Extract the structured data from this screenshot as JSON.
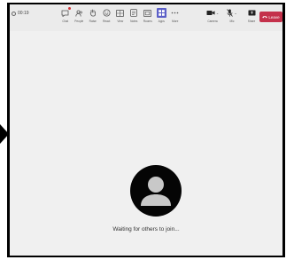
{
  "window": {
    "timer": "00:19"
  },
  "toolbar": {
    "items": [
      {
        "label": "Chat",
        "icon": "chat-icon",
        "badge": true
      },
      {
        "label": "People",
        "icon": "people-icon"
      },
      {
        "label": "Raise",
        "icon": "raise-hand-icon"
      },
      {
        "label": "React",
        "icon": "react-icon"
      },
      {
        "label": "View",
        "icon": "view-icon"
      },
      {
        "label": "Notes",
        "icon": "notes-icon"
      },
      {
        "label": "Rooms",
        "icon": "rooms-icon"
      },
      {
        "label": "Apps",
        "icon": "apps-icon",
        "active": true
      },
      {
        "label": "More",
        "icon": "more-icon"
      }
    ],
    "devices": [
      {
        "label": "Camera",
        "icon": "camera-icon"
      },
      {
        "label": "Mic",
        "icon": "mic-icon"
      },
      {
        "label": "Share",
        "icon": "share-icon"
      }
    ],
    "leave_label": "Leave"
  },
  "stage": {
    "status_text": "Waiting for others to join..."
  },
  "colors": {
    "leave_red": "#c4314b",
    "accent_purple": "#5b5fc7",
    "stage_bg": "#f0f0f0",
    "avatar_bg": "#050505"
  }
}
